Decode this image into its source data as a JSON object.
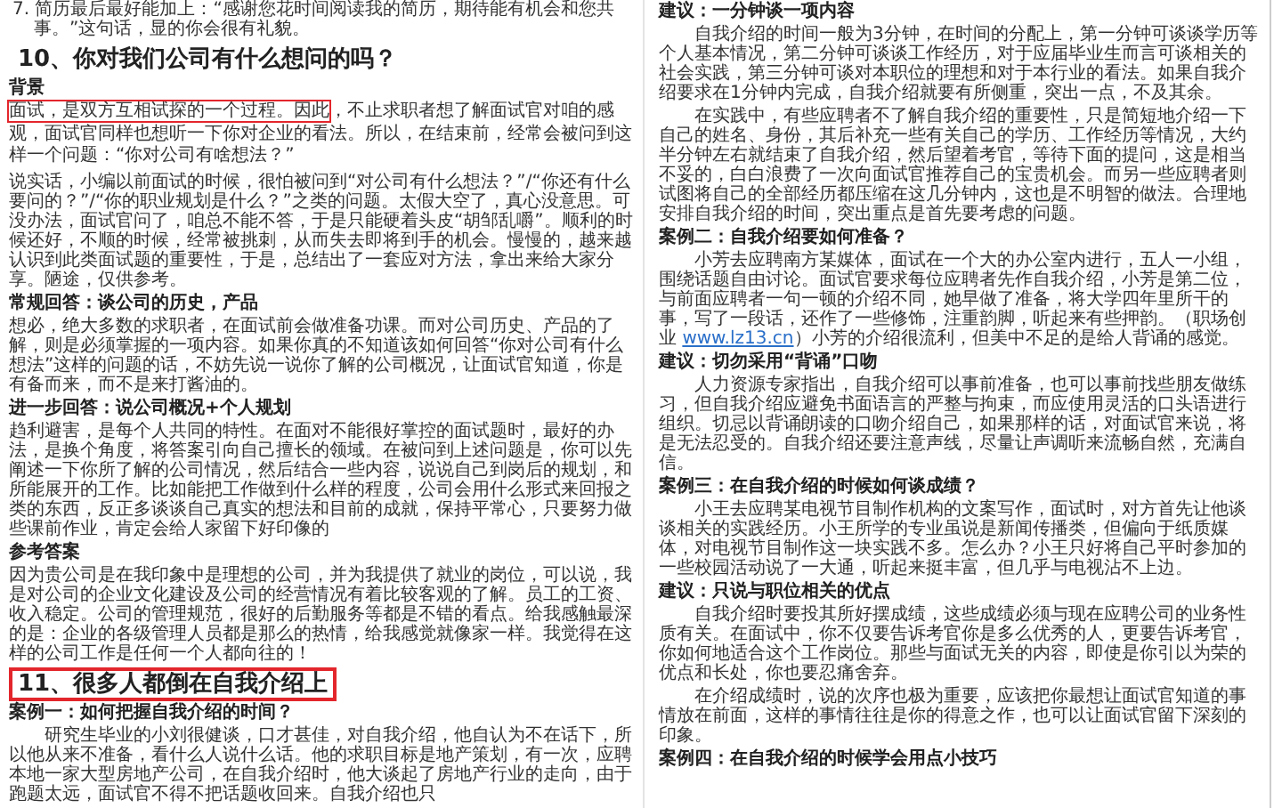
{
  "columns": [
    {
      "blocks": [
        {
          "kind": "list_item",
          "text": "7. 简历最后最好能加上：“感谢您花时间阅读我的简历，期待能有机会和您共事。”这句话，显的你会很有礼貌。"
        },
        {
          "kind": "heading",
          "text": "10、你对我们公司有什么想问的吗？",
          "boxed": false
        },
        {
          "kind": "subheading",
          "text": "背景"
        },
        {
          "kind": "paragraph",
          "indent": false,
          "parts": [
            {
              "kind": "boxed",
              "text": "面试，是双方互相试探的一个过程。因此"
            },
            {
              "kind": "plain",
              "text": "，不止求职者想了解面试官对咱的感观，面试官同样也想听一下你对企业的看法。所以，在结束前，经常会被问到这样一个问题：“你对公司有啥想法？”"
            }
          ]
        },
        {
          "kind": "paragraph",
          "indent": false,
          "parts": [
            {
              "kind": "plain",
              "text": "说实话，小编以前面试的时候，很怕被问到“对公司有什么想法？”/“你还有什么要问的？”/“你的职业规划是什么？”之类的问题。太假大空了，真心没意思。可没办法，面试官问了，咱总不能不答，于是只能硬着头皮“胡邹乱嚼”。顺利的时候还好，不顺的时候，经常被挑刺，从而失去即将到手的机会。慢慢的，越来越认识到此类面试题的重要性，于是，总结出了一套应对方法，拿出来给大家分享。陋途，仅供参考。"
            }
          ]
        },
        {
          "kind": "subheading",
          "text": "常规回答：谈公司的历史，产品"
        },
        {
          "kind": "paragraph",
          "indent": false,
          "parts": [
            {
              "kind": "plain",
              "text": "想必，绝大多数的求职者，在面试前会做准备功课。而对公司历史、产品的了解，则是必须掌握的一项内容。如果你真的不知道该如何回答“你对公司有什么想法”这样的问题的话，不妨先说一说你了解的公司概况，让面试官知道，你是有备而来，而不是来打酱油的。"
            }
          ]
        },
        {
          "kind": "subheading",
          "text": "进一步回答：说公司概况+个人规划"
        },
        {
          "kind": "paragraph",
          "indent": false,
          "parts": [
            {
              "kind": "plain",
              "text": "趋利避害，是每个人共同的特性。在面对不能很好掌控的面试题时，最好的办法，是换个角度，将答案引向自己擅长的领域。在被问到上述问题是，你可以先阐述一下你所了解的公司情况，然后结合一些内容，说说自己到岗后的规划，和所能展开的工作。比如能把工作做到什么样的程度，公司会用什么形式来回报之类的东西，反正多谈谈自己真实的想法和目前的成就，保持平常心，只要努力做些课前作业，肯定会给人家留下好印像的"
            }
          ]
        },
        {
          "kind": "subheading",
          "text": "参考答案"
        },
        {
          "kind": "paragraph",
          "indent": false,
          "parts": [
            {
              "kind": "plain",
              "text": "因为贵公司是在我印象中是理想的公司，并为我提供了就业的岗位，可以说，我是对公司的企业文化建设及公司的经营情况有着比较客观的了解。员工的工资、收入稳定。公司的管理规范，很好的后勤服务等都是不错的看点。给我感触最深的是：企业的各级管理人员都是那么的热情，给我感觉就像家一样。我觉得在这样的公司工作是任何一个人都向往的！"
            }
          ]
        },
        {
          "kind": "heading",
          "text": "11、很多人都倒在自我介绍上",
          "boxed": true
        },
        {
          "kind": "subheading",
          "text": "案例一：如何把握自我介绍的时间？"
        },
        {
          "kind": "paragraph",
          "indent": true,
          "parts": [
            {
              "kind": "plain",
              "text": "研究生毕业的小刘很健谈，口才甚佳，对自我介绍，他自认为不在话下，所以他从来不准备，看什么人说什么话。他的求职目标是地产策划，有一次，应聘本地一家大型房地产公司，在自我介绍时，他大谈起了房地产行业的走向，由于跑题太远，面试官不得不把话题收回来。自我介绍也只"
            }
          ]
        }
      ]
    },
    {
      "blocks": [
        {
          "kind": "subheading",
          "text": "建议：一分钟谈一项内容"
        },
        {
          "kind": "paragraph",
          "indent": true,
          "parts": [
            {
              "kind": "plain",
              "text": "自我介绍的时间一般为3分钟，在时间的分配上，第一分钟可谈谈学历等个人基本情况，第二分钟可谈谈工作经历，对于应届毕业生而言可谈相关的社会实践，第三分钟可谈对本职位的理想和对于本行业的看法。如果自我介绍要求在1分钟内完成，自我介绍就要有所侧重，突出一点，不及其余。"
            }
          ]
        },
        {
          "kind": "paragraph",
          "indent": true,
          "parts": [
            {
              "kind": "plain",
              "text": "在实践中，有些应聘者不了解自我介绍的重要性，只是简短地介绍一下自己的姓名、身份，其后补充一些有关自己的学历、工作经历等情况，大约半分钟左右就结束了自我介绍，然后望着考官，等待下面的提问，这是相当不妥的，白白浪费了一次向面试官推荐自己的宝贵机会。而另一些应聘者则试图将自己的全部经历都压缩在这几分钟内，这也是不明智的做法。合理地安排自我介绍的时间，突出重点是首先要考虑的问题。"
            }
          ]
        },
        {
          "kind": "subheading",
          "text": "案例二：自我介绍要如何准备？"
        },
        {
          "kind": "paragraph",
          "indent": true,
          "parts": [
            {
              "kind": "plain",
              "text": "小芳去应聘南方某媒体，面试在一个大的办公室内进行，五人一小组，围绕话题自由讨论。面试官要求每位应聘者先作自我介绍，小芳是第二位，与前面应聘者一句一顿的介绍不同，她早做了准备，将大学四年里所干的事，写了一段话，还作了一些修饰，注重韵脚，听起来有些押韵。（职场创业 "
            },
            {
              "kind": "link",
              "text": "www.lz13.cn"
            },
            {
              "kind": "plain",
              "text": "）小芳的介绍很流利，但美中不足的是给人背诵的感觉。"
            }
          ]
        },
        {
          "kind": "subheading",
          "text": "建议：切勿采用“背诵”口吻"
        },
        {
          "kind": "paragraph",
          "indent": true,
          "parts": [
            {
              "kind": "plain",
              "text": "人力资源专家指出，自我介绍可以事前准备，也可以事前找些朋友做练习，但自我介绍应避免书面语言的严整与拘束，而应使用灵活的口头语进行组织。切忌以背诵朗读的口吻介绍自己，如果那样的话，对面试官来说，将是无法忍受的。自我介绍还要注意声线，尽量让声调听来流畅自然，充满自信。"
            }
          ]
        },
        {
          "kind": "subheading",
          "text": "案例三：在自我介绍的时候如何谈成绩？"
        },
        {
          "kind": "paragraph",
          "indent": true,
          "parts": [
            {
              "kind": "plain",
              "text": "小王去应聘某电视节目制作机构的文案写作，面试时，对方首先让他谈谈相关的实践经历。小王所学的专业虽说是新闻传播类，但偏向于纸质媒体，对电视节目制作这一块实践不多。怎么办？小王只好将自己平时参加的一些校园活动说了一大通，听起来挺丰富，但几乎与电视沾不上边。"
            }
          ]
        },
        {
          "kind": "subheading",
          "text": "建议：只说与职位相关的优点"
        },
        {
          "kind": "paragraph",
          "indent": true,
          "parts": [
            {
              "kind": "plain",
              "text": "自我介绍时要投其所好摆成绩，这些成绩必须与现在应聘公司的业务性质有关。在面试中，你不仅要告诉考官你是多么优秀的人，更要告诉考官，你如何地适合这个工作岗位。那些与面试无关的内容，即使是你引以为荣的优点和长处，你也要忍痛舍弃。"
            }
          ]
        },
        {
          "kind": "paragraph",
          "indent": true,
          "parts": [
            {
              "kind": "plain",
              "text": "在介绍成绩时，说的次序也极为重要，应该把你最想让面试官知道的事情放在前面，这样的事情往往是你的得意之作，也可以让面试官留下深刻的印象。"
            }
          ]
        },
        {
          "kind": "subheading",
          "text": "案例四：在自我介绍的时候学会用点小技巧"
        }
      ]
    }
  ]
}
